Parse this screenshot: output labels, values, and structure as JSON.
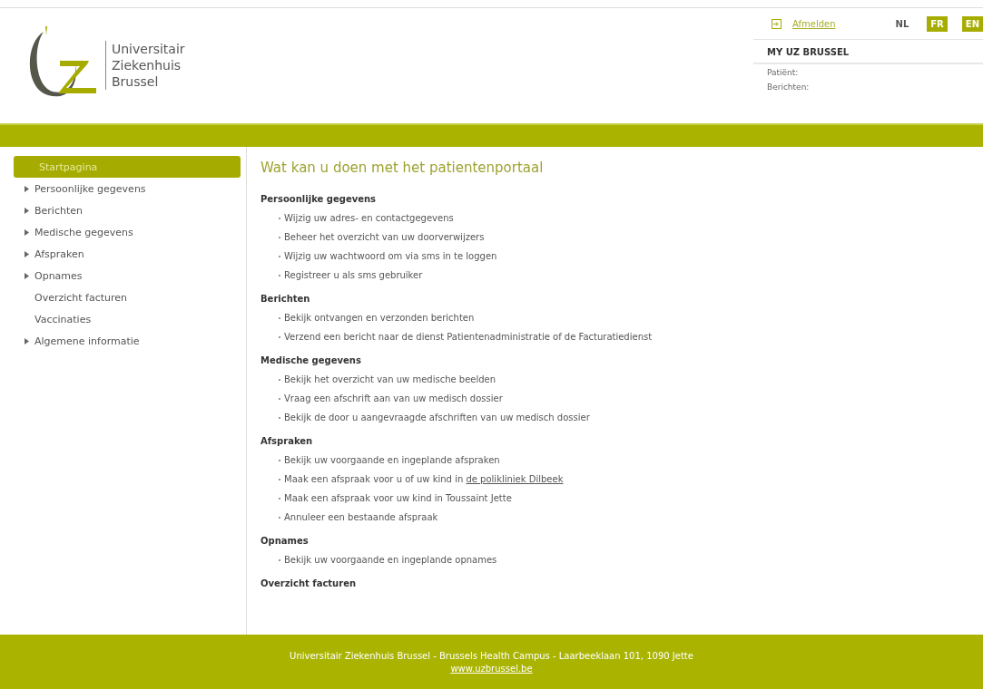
{
  "logo": {
    "lines": [
      "Universitair",
      "Ziekenhuis",
      "Brussel"
    ]
  },
  "header": {
    "logout": "Afmelden",
    "languages": [
      {
        "label": "NL",
        "selected": true
      },
      {
        "label": "FR",
        "selected": false
      },
      {
        "label": "EN",
        "selected": false
      }
    ],
    "portal_title": "MY UZ BRUSSEL",
    "info": [
      "Patiënt:",
      "Berichten:"
    ]
  },
  "sidebar": {
    "items": [
      {
        "label": "Startpagina",
        "kind": "link",
        "selected": true
      },
      {
        "label": "Persoonlijke gegevens",
        "kind": "group",
        "selected": false
      },
      {
        "label": "Berichten",
        "kind": "group",
        "selected": false
      },
      {
        "label": "Medische gegevens",
        "kind": "group",
        "selected": false
      },
      {
        "label": "Afspraken",
        "kind": "group",
        "selected": false
      },
      {
        "label": "Opnames",
        "kind": "group",
        "selected": false
      },
      {
        "label": "Overzicht facturen",
        "kind": "link",
        "selected": false
      },
      {
        "label": "Vaccinaties",
        "kind": "link",
        "selected": false
      },
      {
        "label": "Algemene informatie",
        "kind": "group",
        "selected": false
      }
    ]
  },
  "content": {
    "title": "Wat kan u doen met het patientenportaal",
    "sections": [
      {
        "heading": "Persoonlijke gegevens",
        "items": [
          {
            "text": "Wijzig uw adres- en contactgegevens"
          },
          {
            "text": "Beheer het overzicht van uw doorverwijzers"
          },
          {
            "text": "Wijzig uw wachtwoord om via sms in te loggen"
          },
          {
            "text": "Registreer u als sms gebruiker"
          }
        ]
      },
      {
        "heading": "Berichten",
        "items": [
          {
            "text": "Bekijk ontvangen en verzonden berichten"
          },
          {
            "text": "Verzend een bericht naar de dienst Patientenadministratie of de Facturatiedienst"
          }
        ]
      },
      {
        "heading": "Medische gegevens",
        "items": [
          {
            "text": "Bekijk het overzicht van uw medische beelden"
          },
          {
            "text": "Vraag een afschrift aan van uw medisch dossier"
          },
          {
            "text": "Bekijk de door u aangevraagde afschriften van uw medisch dossier"
          }
        ]
      },
      {
        "heading": "Afspraken",
        "items": [
          {
            "text": "Bekijk uw voorgaande en ingeplande afspraken"
          },
          {
            "text": "Maak een afspraak voor u of uw kind in",
            "link": "de polikliniek Dilbeek"
          },
          {
            "text": "Maak een afspraak voor uw kind in Toussaint Jette"
          },
          {
            "text": "Annuleer een bestaande afspraak"
          }
        ]
      },
      {
        "heading": "Opnames",
        "items": [
          {
            "text": "Bekijk uw voorgaande en ingeplande opnames"
          }
        ]
      },
      {
        "heading": "Overzicht facturen"
      }
    ]
  },
  "footer": {
    "address": "Universitair Ziekenhuis Brussel - Brussels Health Campus - Laarbeeklaan 101, 1090 Jette",
    "url": "www.uzbrussel.be"
  }
}
